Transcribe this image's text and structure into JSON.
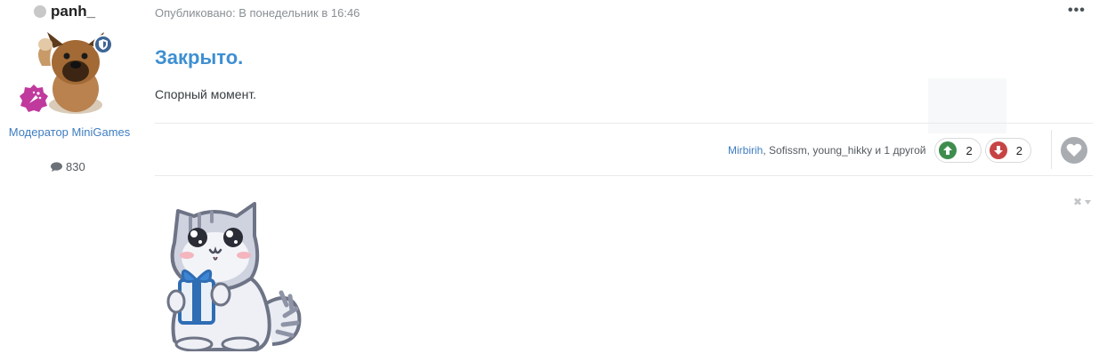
{
  "author": {
    "name": "panh_",
    "title": "Модератор MiniGames",
    "post_count": "830",
    "colors": {
      "online_dot": "#c8c8c8",
      "moderator_badge": "#3d6594",
      "rank_badge": "#c0399c"
    }
  },
  "post": {
    "meta": "Опубликовано: В понедельник в 16:46",
    "title": "Закрыто.",
    "body": "Спорный момент.",
    "menu_icon": "ellipsis-icon"
  },
  "reactions": {
    "names_link": "Mirbirih",
    "names_rest": ", Sofissm, young_hikky и 1 другой",
    "upvotes": "2",
    "downvotes": "2",
    "colors": {
      "up": "#3f8d4e",
      "down": "#c74444",
      "like": "#a9adb2"
    }
  },
  "signature": {
    "image": "cat-with-gift-sticker",
    "controls_icon": "close-dropdown-icon"
  },
  "colors": {
    "accent": "#3e8fd2",
    "link": "#3e7dc0"
  }
}
